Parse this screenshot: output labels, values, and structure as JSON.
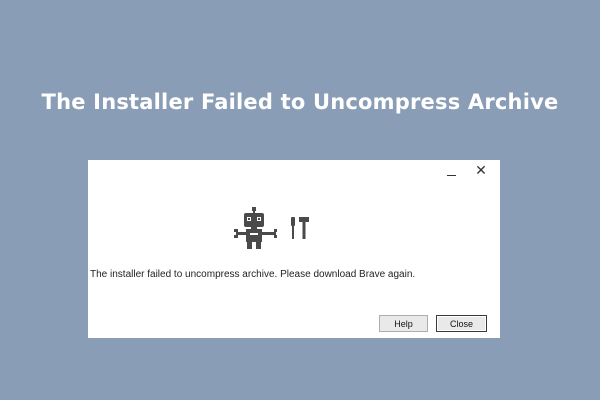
{
  "banner": {
    "title": "The Installer Failed to Uncompress Archive"
  },
  "dialog": {
    "controls": {
      "minimize_icon": "minimize-icon",
      "close_glyph": "✕"
    },
    "illustration_icons": [
      "robot-icon",
      "tools-icon"
    ],
    "message": "The installer failed to uncompress archive. Please download Brave again.",
    "buttons": {
      "help": "Help",
      "close": "Close"
    }
  },
  "colors": {
    "background": "#8a9db6",
    "dialog": "#ffffff",
    "illustration": "#4a4a4a"
  }
}
